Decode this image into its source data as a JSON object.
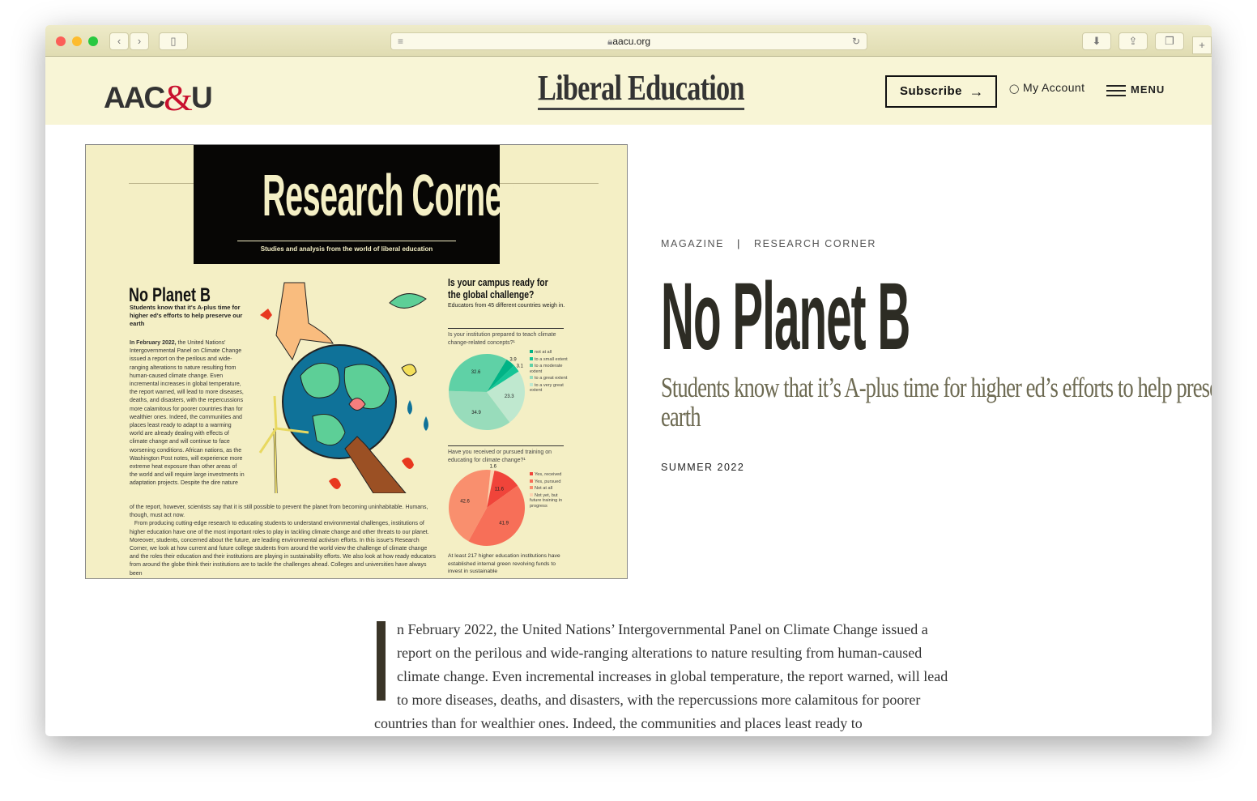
{
  "browser": {
    "url": "aacu.org"
  },
  "header": {
    "logo_left": "AAC",
    "logo_amp": "&",
    "logo_right": "U",
    "masthead": "Liberal Education",
    "subscribe": "Subscribe",
    "subscribe_arrow": "→",
    "account": "My Account",
    "account_icon": "👤",
    "menu": "MENU"
  },
  "magazine": {
    "banner_title": "Research Corner",
    "banner_subtitle": "Studies and analysis from the world of liberal education",
    "title": "No Planet B",
    "subtitle": "Students know that it's A-plus time for higher ed's efforts to help preserve our earth",
    "lead_bold": "In February 2022,",
    "col_text": " the United Nations' Intergovernmental Panel on Climate Change issued a report on the perilous and wide-ranging alterations to nature resulting from human-caused climate change. Even incremental increases in global temperature, the report warned, will lead to more diseases, deaths, and disasters, with the repercussions more calamitous for poorer countries than for wealthier ones. Indeed, the communities and places least ready to adapt to a warming world are already dealing with effects of climate change and will continue to face worsening conditions. African nations, as the Washington Post notes, will experience more extreme heat exposure than other areas of the world and will require large investments in adaptation projects. Despite the dire nature",
    "wide_text": "of the report, however, scientists say that it is still possible to prevent the planet from becoming uninhabitable. Humans, though, must act now.",
    "wide_text2": "From producing cutting-edge research to educating students to understand environmental challenges, institutions of higher education have one of the most important roles to play in tackling climate change and other threats to our planet. Moreover, students, concerned about the future, are leading environmental activism efforts. In this issue's Research Corner, we look at how current and future college students from around the world view the challenge of climate change and the roles their education and their institutions are playing in sustainability efforts. We also look at how ready educators from around the globe think their institutions are to tackle the challenges ahead. Colleges and universities have always been",
    "side_title": "Is your campus ready for the global challenge?",
    "side_sub": "Educators from 45 different countries weigh in.",
    "side_footer": "At least 217 higher education institutions have established internal green revolving funds to invest in sustainable"
  },
  "chart_data": [
    {
      "type": "pie",
      "title": "Is your institution prepared to teach climate change-related concepts?¹",
      "categories": [
        "not at all",
        "to a small extent",
        "to a very great extent",
        "to a great extent",
        "to a moderate extent"
      ],
      "values": [
        3.9,
        3.1,
        23.3,
        34.9,
        32.6
      ],
      "colors": [
        "#00b386",
        "#14c597",
        "#bfe8cf",
        "#98dcbb",
        "#5fd1a6"
      ],
      "legend": [
        {
          "label": "not at all",
          "color": "#00b386"
        },
        {
          "label": "to a small extent",
          "color": "#14c597"
        },
        {
          "label": "to a moderate extent",
          "color": "#5fd1a6"
        },
        {
          "label": "to a great extent",
          "color": "#98dcbb"
        },
        {
          "label": "to a very great extent",
          "color": "#bfe8cf"
        }
      ]
    },
    {
      "type": "pie",
      "title": "Have you received or pursued training on educating for climate change?¹",
      "categories": [
        "Not yet, but future training in progress",
        "Yes, received",
        "Yes, pursued",
        "Not at all"
      ],
      "values": [
        1.6,
        11.6,
        41.9,
        42.6
      ],
      "colors": [
        "#fbd3b0",
        "#f0443a",
        "#f76f58",
        "#f98f6e"
      ],
      "legend": [
        {
          "label": "Yes, received",
          "color": "#f0443a"
        },
        {
          "label": "Yes, pursued",
          "color": "#f76f58"
        },
        {
          "label": "Not at all",
          "color": "#f98f6e"
        },
        {
          "label": "Not yet, but future training in progress",
          "color": "#fbd3b0"
        }
      ]
    }
  ],
  "article": {
    "category": "MAGAZINE",
    "separator": "|",
    "section": "RESEARCH CORNER",
    "title": "No Planet B",
    "dek": "Students know that it’s A-plus time for higher ed’s efforts to help preserve our earth",
    "issue": "SUMMER 2022",
    "dropcap": "I",
    "body": "n February 2022, the United Nations’ Intergovernmental Panel on Climate Change issued a report on the perilous and wide-ranging alterations to nature resulting from human-caused climate change. Even incremental increases in global temperature, the report warned, will lead to more diseases, deaths, and disasters, with the repercussions more calamitous for poorer countries than for wealthier ones. Indeed, the communities and places least ready to"
  }
}
